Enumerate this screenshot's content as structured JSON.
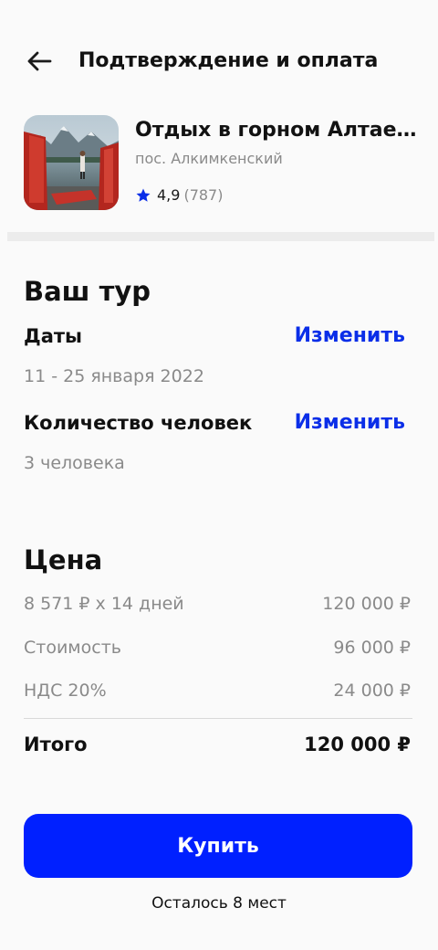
{
  "header": {
    "title": "Подтверждение и оплата",
    "back_icon": "arrow-left-icon"
  },
  "tour": {
    "title": "Отдых в горном Алтае…",
    "location": "пос. Алкимкенский",
    "rating": "4,9",
    "reviews": "(787)",
    "star_color": "#0a2ee8"
  },
  "your_tour": {
    "title": "Ваш тур",
    "dates_label": "Даты",
    "dates_value": "11 - 25 января 2022",
    "people_label": "Количество человек",
    "people_value": "3 человека",
    "change_label": "Изменить"
  },
  "price": {
    "title": "Цена",
    "rows": [
      {
        "label": "8 571 ₽ x 14 дней",
        "value": "120 000 ₽"
      },
      {
        "label": "Стоимость",
        "value": "96 000 ₽"
      },
      {
        "label": "НДС 20%",
        "value": "24 000 ₽"
      }
    ],
    "total_label": "Итого",
    "total_value": "120 000 ₽"
  },
  "buy_button": "Купить",
  "seats_left": "Осталось 8 мест",
  "colors": {
    "accent": "#0020ff",
    "link": "#0a2ee8",
    "muted": "#8a8a8a"
  }
}
